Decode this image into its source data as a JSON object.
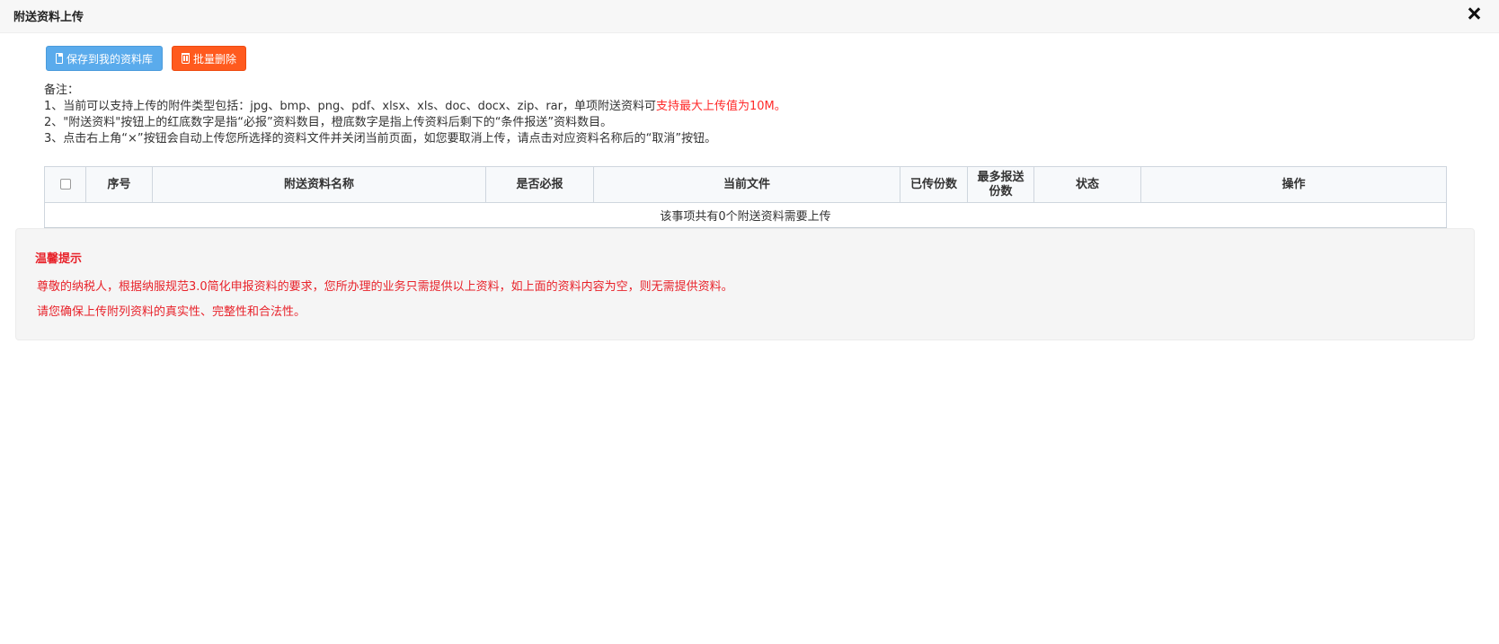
{
  "dialog": {
    "title": "附送资料上传",
    "close_label": "×"
  },
  "toolbar": {
    "save_label": "保存到我的资料库",
    "batch_delete_label": "批量删除"
  },
  "notes": {
    "heading": "备注：",
    "line1_prefix": "1、当前可以支持上传的附件类型包括：jpg、bmp、png、pdf、xlsx、xls、doc、docx、zip、rar，单项附送资料可",
    "line1_highlight": "支持最大上传值为10M。",
    "line2": "2、\"附送资料\"按钮上的红底数字是指“必报”资料数目，橙底数字是指上传资料后剩下的“条件报送”资料数目。",
    "line3": "3、点击右上角“×”按钮会自动上传您所选择的资料文件并关闭当前页面，如您要取消上传，请点击对应资料名称后的“取消”按钮。"
  },
  "table": {
    "columns": [
      "序号",
      "附送资料名称",
      "是否必报",
      "当前文件",
      "已传份数",
      "最多报送份数",
      "状态",
      "操作"
    ],
    "empty_message": "该事项共有0个附送资料需要上传"
  },
  "tips": {
    "title": "温馨提示",
    "line1": "尊敬的纳税人，根据纳服规范3.0简化申报资料的要求，您所办理的业务只需提供以上资料，如上面的资料内容为空，则无需提供资料。",
    "line2": "请您确保上传附列资料的真实性、完整性和合法性。"
  },
  "colors": {
    "save_button": "#5aabec",
    "delete_button": "#ff5a1e",
    "warning_text": "#e8222a"
  }
}
